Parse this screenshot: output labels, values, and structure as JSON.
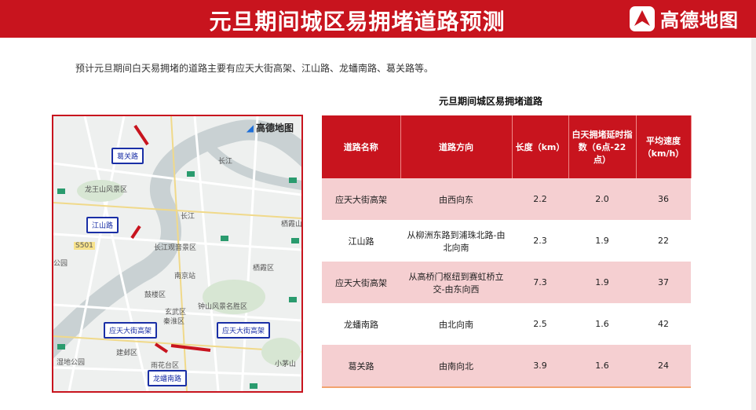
{
  "header": {
    "title": "元旦期间城区易拥堵道路预测",
    "logo_text": "高德地图"
  },
  "intro": "预计元旦期间白天易拥堵的道路主要有应天大街高架、江山路、龙蟠南路、葛关路等。",
  "table": {
    "title": "元旦期间城区易拥堵道路",
    "columns": [
      "道路名称",
      "道路方向",
      "长度（km）",
      "白天拥堵延时指数（6点-22点）",
      "平均速度（km/h）"
    ],
    "rows": [
      [
        "应天大街高架",
        "由西向东",
        "2.2",
        "2.0",
        "36"
      ],
      [
        "江山路",
        "从柳洲东路到浦珠北路-由北向南",
        "2.3",
        "1.9",
        "22"
      ],
      [
        "应天大街高架",
        "从高桥门枢纽到赛虹桥立交-由东向西",
        "7.3",
        "1.9",
        "37"
      ],
      [
        "龙蟠南路",
        "由北向南",
        "2.5",
        "1.6",
        "42"
      ],
      [
        "葛关路",
        "由南向北",
        "3.9",
        "1.6",
        "24"
      ]
    ]
  },
  "map": {
    "logo_text": "高德地图",
    "tags": [
      "葛关路",
      "江山路",
      "应天大街高架",
      "应天大街高架",
      "龙蟠南路"
    ],
    "labels": [
      "龙王山风景区",
      "长江",
      "长江观音景区",
      "南京站",
      "栖霞区",
      "钟山风景名胜区",
      "鼓楼区",
      "玄武区",
      "秦淮区",
      "建邺区",
      "雨花台区",
      "小茅山",
      "湿地公园",
      "公园",
      "栖霞山",
      "S501",
      "长江"
    ]
  },
  "colors": {
    "brand_red": "#c8141e",
    "row_pink": "#f5cfd1",
    "tag_blue": "#1a2fa6"
  }
}
